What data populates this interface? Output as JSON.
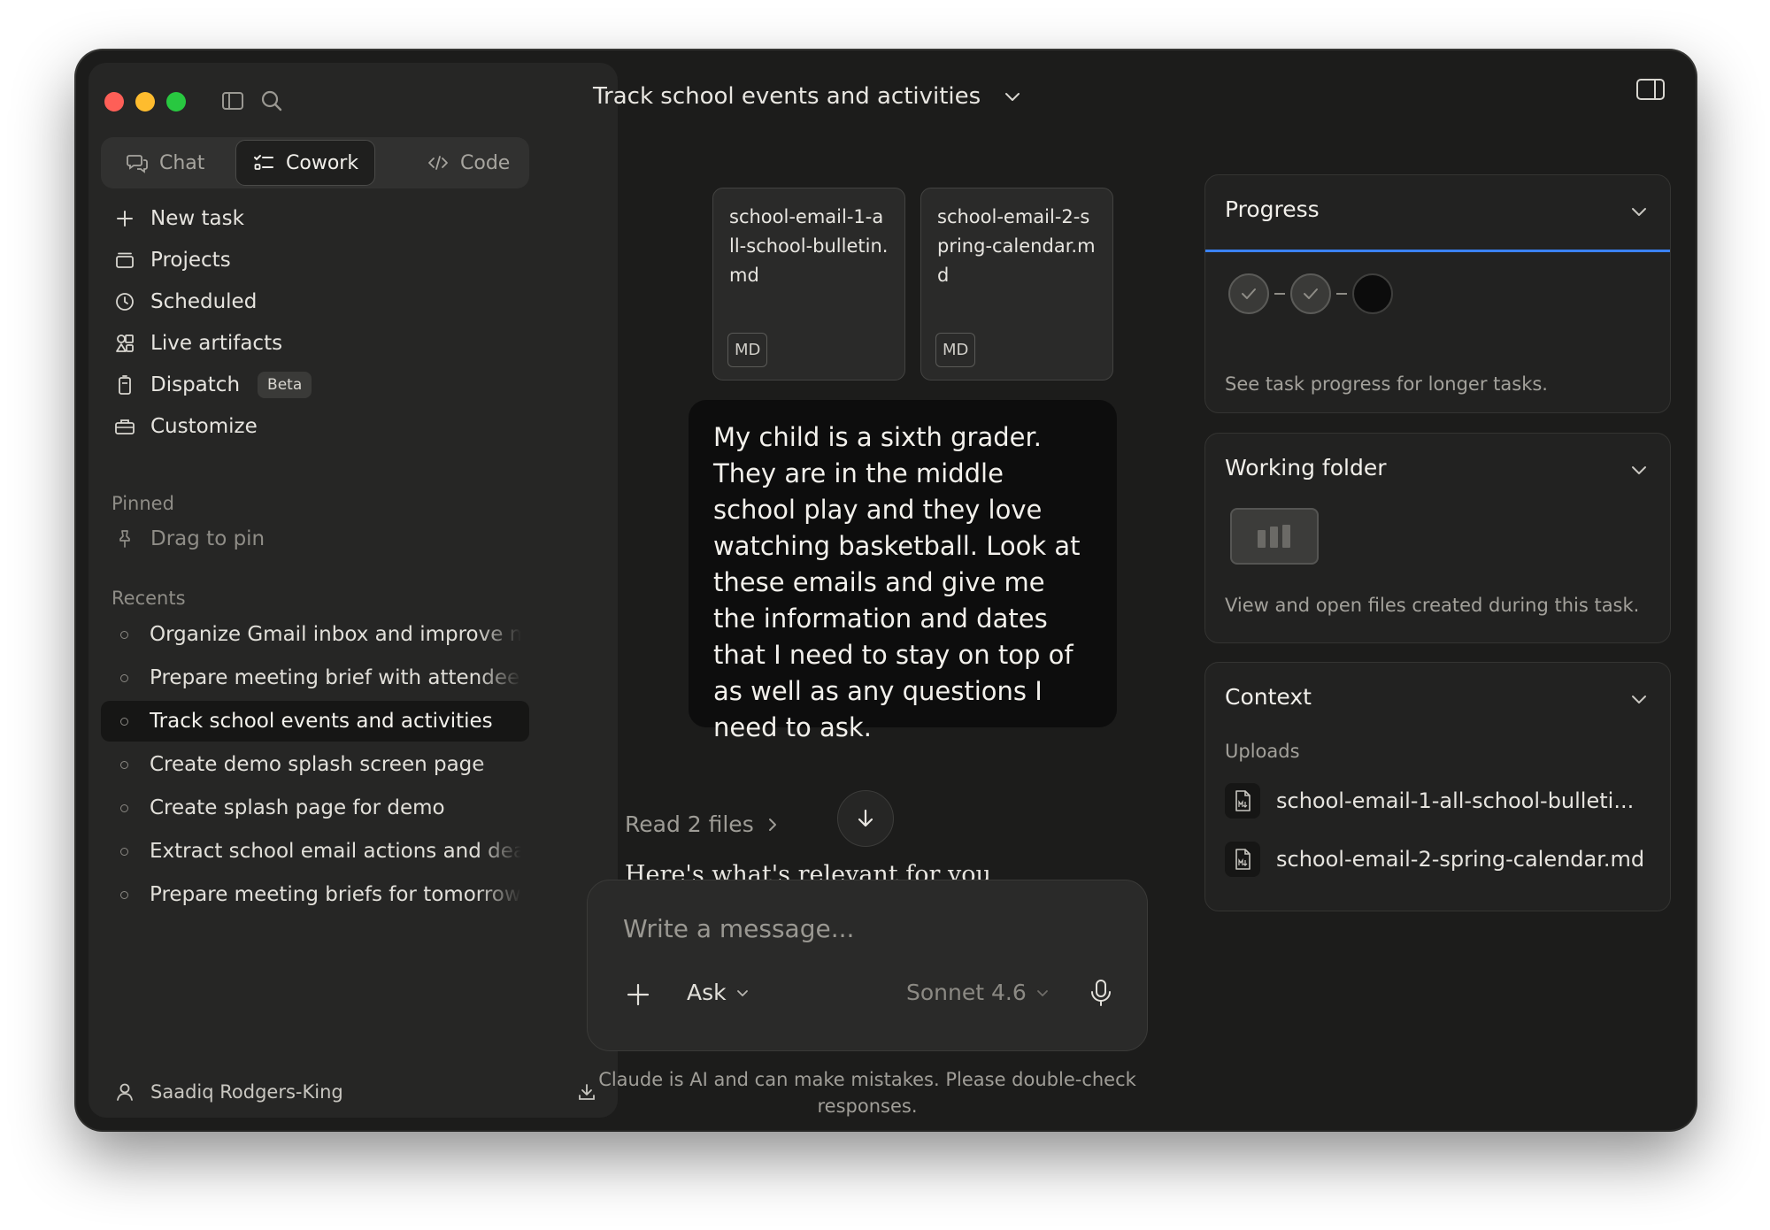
{
  "sidebar": {
    "modes": [
      {
        "label": "Chat",
        "icon": "chat-bubbles-icon"
      },
      {
        "label": "Cowork",
        "icon": "checklist-icon"
      },
      {
        "label": "Code",
        "icon": "code-icon"
      }
    ],
    "nav": [
      {
        "label": "New task",
        "icon": "plus-icon"
      },
      {
        "label": "Projects",
        "icon": "folder-icon"
      },
      {
        "label": "Scheduled",
        "icon": "clock-icon"
      },
      {
        "label": "Live artifacts",
        "icon": "shapes-icon"
      },
      {
        "label": "Dispatch",
        "icon": "phone-icon",
        "badge": "Beta"
      },
      {
        "label": "Customize",
        "icon": "briefcase-icon"
      }
    ],
    "pinned_label": "Pinned",
    "drag_to_pin": "Drag to pin",
    "recents_label": "Recents",
    "recents": [
      "Organize Gmail inbox and improve management",
      "Prepare meeting brief with attendee research",
      "Track school events and activities",
      "Create demo splash screen page",
      "Create splash page for demo",
      "Extract school email actions and deadlines",
      "Prepare meeting briefs for tomorrow"
    ],
    "active_recent": 2,
    "user_name": "Saadiq Rodgers-King"
  },
  "main": {
    "title": "Track school events and activities",
    "attachments": [
      {
        "name": "school-email-1-all-school-bulletin.md",
        "type": "MD"
      },
      {
        "name": "school-email-2-spring-calendar.md",
        "type": "MD"
      }
    ],
    "user_message": "My child is a sixth grader. They are in the middle school play and they love watching basketball. Look at these emails and give me the information and dates that I need to stay on top of as well as any questions I need to ask.",
    "read_files": "Read 2 files",
    "partial_response": "Here's what's relevant for you",
    "composer": {
      "placeholder": "Write a message...",
      "mode": "Ask",
      "model": "Sonnet 4.6"
    },
    "disclaimer": "Claude is AI and can make mistakes. Please double-check responses."
  },
  "right_panel": {
    "progress": {
      "title": "Progress",
      "description": "See task progress for longer tasks.",
      "steps_done": 2,
      "steps_total": 3
    },
    "working_folder": {
      "title": "Working folder",
      "description": "View and open files created during this task."
    },
    "context": {
      "title": "Context",
      "uploads_label": "Uploads",
      "uploads": [
        "school-email-1-all-school-bulleti...",
        "school-email-2-spring-calendar.md"
      ]
    }
  },
  "colors": {
    "accent_blue": "#3b82f6",
    "window_bg": "#1c1c1b",
    "sidebar_bg": "#262625"
  }
}
